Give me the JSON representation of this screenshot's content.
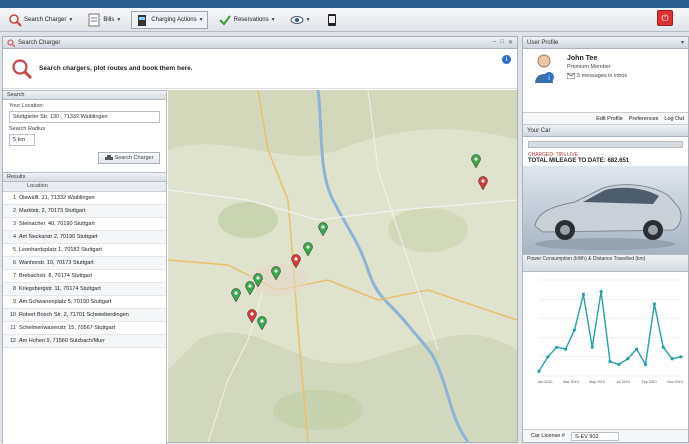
{
  "toolbar": {
    "items": [
      {
        "label": "Search Charger",
        "icon": "search-icon"
      },
      {
        "label": "Bills",
        "icon": "bills-icon"
      },
      {
        "label": "Charging Actions",
        "icon": "charging-icon"
      },
      {
        "label": "Reservations",
        "icon": "reservation-icon"
      }
    ]
  },
  "search_panel": {
    "title": "Search Charger",
    "intro": "Search chargers, plot routes and book them here.",
    "search_section": "Search",
    "location_label": "Your Location:",
    "location_value": "Stuttgarter Str. 130 , 71332 Waiblingen",
    "radius_label": "Search Radius",
    "radius_value": "5 km",
    "search_button": "Search Charger",
    "results_section": "Results",
    "results_column": "Location",
    "results": [
      {
        "n": "1",
        "loc": "Olewällt. 21, 71332 Waiblingen"
      },
      {
        "n": "2",
        "loc": "Marktstr. 2, 70173 Stuttgart"
      },
      {
        "n": "3",
        "loc": "Steinacher. 40, 70190 Stuttgart"
      },
      {
        "n": "4",
        "loc": "Am Neckarstr 2, 70190 Stuttgart"
      },
      {
        "n": "5",
        "loc": "Leonhardsplatz 1, 70182 Stuttgart"
      },
      {
        "n": "6",
        "loc": "Wanhorstr. 10, 70173 Stuttgart"
      },
      {
        "n": "7",
        "loc": "Brebachstr. 8, 70174 Stuttgart"
      },
      {
        "n": "8",
        "loc": "Kriegsbergstr. 11, 70174 Stuttgart"
      },
      {
        "n": "9",
        "loc": "Am Schwanenplatz 5, 70190 Stuttgart"
      },
      {
        "n": "10",
        "loc": "Robert Bosch Str. 2, 71701 Schwieberdingen"
      },
      {
        "n": "11",
        "loc": "Schelmenwasenstr. 15, 70567 Stuttgart"
      },
      {
        "n": "12",
        "loc": "Am Hohen 9, 71560 Sulzbach/Murr"
      }
    ]
  },
  "profile": {
    "section": "User Profile",
    "name": "John Tee",
    "type": "Premium Member",
    "messages": "5 messages in inbox",
    "links": [
      "Edit Profile",
      "Preferences",
      "Log Out"
    ]
  },
  "car": {
    "section": "Your Car",
    "charge_status": "CHARGED: 78% LIVE",
    "mileage": "TOTAL MILEAGE TO DATE: 682.651"
  },
  "consumption": {
    "title": "Power Consumption (kWh) & Distance Travelled (km)",
    "license_label": "Car License #",
    "license_value": "S-EV 902"
  },
  "chart_data": {
    "type": "line",
    "title": "Power Consumption (kWh) & Distance Travelled (km)",
    "x_labels": [
      "Jan 2010",
      "Mar 2010",
      "May 2010",
      "Jul 2010",
      "Sep 2010",
      "Nov 2010"
    ],
    "values": [
      5,
      20,
      30,
      28,
      48,
      85,
      30,
      88,
      15,
      12,
      18,
      28,
      12,
      75,
      30,
      18,
      20
    ],
    "ylim": [
      0,
      100
    ],
    "color": "#1fa3a8"
  },
  "colors": {
    "accent": "#2b5d8f",
    "pin_green": "#3aa84c",
    "pin_red": "#d63b3b",
    "river": "#8fb3d6"
  }
}
